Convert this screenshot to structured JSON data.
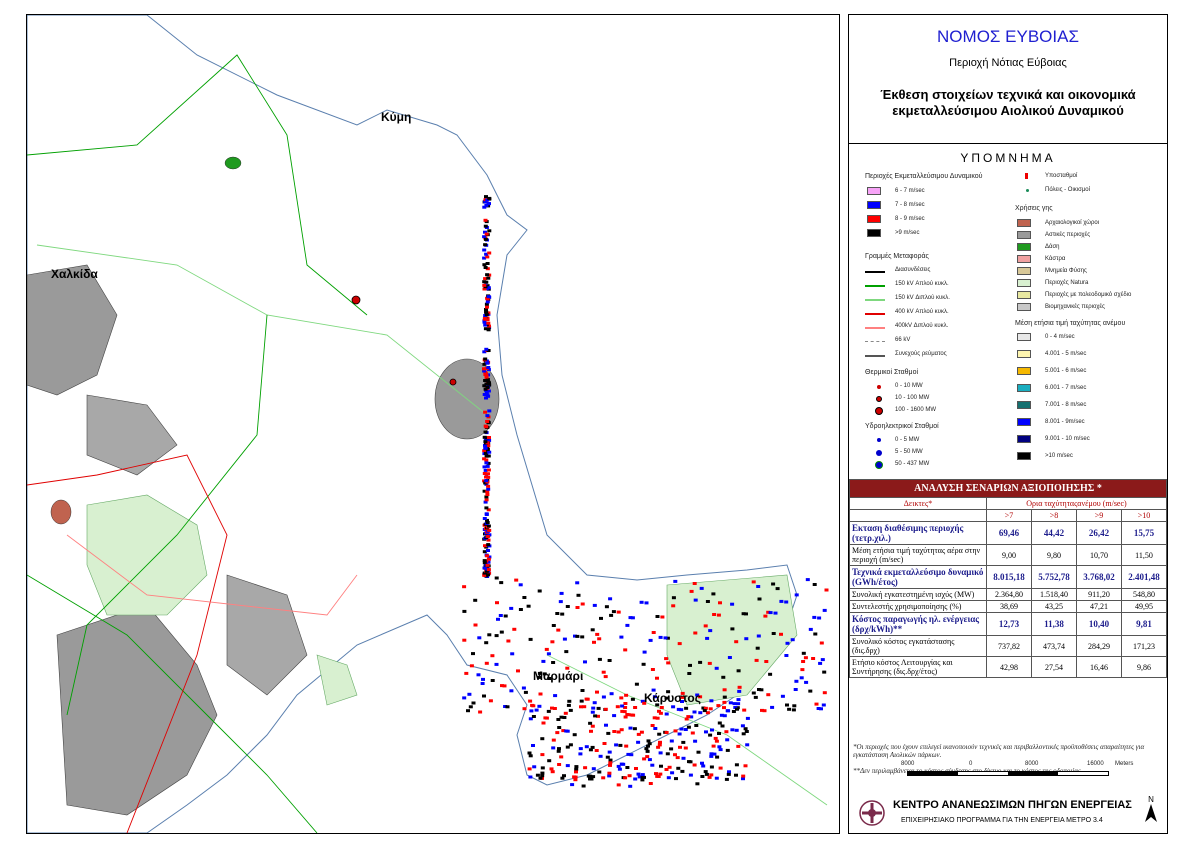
{
  "map": {
    "places": {
      "kymi": "Κύμη",
      "chalkida": "Χαλκίδα",
      "marmari": "Μαρμάρι",
      "karystos": "Κάρυστος"
    }
  },
  "header": {
    "title": "ΝΟΜΟΣ ΕΥΒΟΙΑΣ",
    "subtitle": "Περιοχή Νότιας Εύβοιας",
    "report": "Έκθεση στοιχείων τεχνικά και οικονομικά εκμεταλλεύσιμου Αιολικού Δυναμικού"
  },
  "legend": {
    "title": "ΥΠΟΜΝΗΜΑ",
    "left": {
      "wind_heading": "Περιοχές Εκμεταλλεύσιμου Δυναμικού",
      "wind_items": [
        {
          "label": "6 - 7 m/sec",
          "color": "#f7a3f7"
        },
        {
          "label": "7 - 8 m/sec",
          "color": "#0000ff"
        },
        {
          "label": "8 - 9 m/sec",
          "color": "#ff0000"
        },
        {
          "label": ">9 m/sec",
          "color": "#000000"
        }
      ],
      "lines_heading": "Γραμμές Μεταφοράς",
      "line_items": [
        {
          "label": "Διασυνδέσεις",
          "color": "#000000"
        },
        {
          "label": "150 kV Απλού κυκλ.",
          "color": "#00a000"
        },
        {
          "label": "150 kV Διπλού κυκλ.",
          "color": "#7fd87f"
        },
        {
          "label": "400 kV Απλού κυκλ.",
          "color": "#e00000"
        },
        {
          "label": "400kV Διπλού κυκλ.",
          "color": "#ff8080"
        },
        {
          "label": "66 kV",
          "color": "#888888"
        },
        {
          "label": "Συνεχούς ρεύματος",
          "color": "#555555"
        }
      ],
      "thermal_heading": "Θερμικοί Σταθμοί",
      "thermal_items": [
        "0 - 10 MW",
        "10 - 100 MW",
        "100 - 1600 MW"
      ],
      "hydro_heading": "Υδροηλεκτρικοί Σταθμοί",
      "hydro_items": [
        "0 - 5 MW",
        "5 - 50 MW",
        "50 - 437 MW"
      ]
    },
    "right": {
      "substations": "Υποσταθμοί",
      "towns": "Πόλεις - Οικισμοί",
      "landuse_heading": "Χρήσεις γης",
      "landuse_items": [
        {
          "label": "Αρχαιολογικοί χώροι",
          "color": "#c0634f"
        },
        {
          "label": "Αστικές περιοχές",
          "color": "#9a9a9a"
        },
        {
          "label": "Δάση",
          "color": "#1f9a1f"
        },
        {
          "label": "Κάστρα",
          "color": "#f0a0a0"
        },
        {
          "label": "Μνημεία Φύσης",
          "color": "#d8c898"
        },
        {
          "label": "Περιοχές Natura",
          "color": "#d8f0d0"
        },
        {
          "label": "Περιοχές με πολεοδομικό σχέδιο",
          "color": "#e8e8a0"
        },
        {
          "label": "Βιομηχανικές περιοχές",
          "color": "#c8c8c8"
        }
      ],
      "wind_speed_heading": "Μέση ετήσια τιμή ταχύτητας ανέμου",
      "wind_speed_items": [
        {
          "label": "0 - 4 m/sec",
          "color": "#e8e8e8"
        },
        {
          "label": "4.001 - 5 m/sec",
          "color": "#fff6b0"
        },
        {
          "label": "5.001 - 6 m/sec",
          "color": "#f5b800"
        },
        {
          "label": "6.001 - 7 m/sec",
          "color": "#1aaec0"
        },
        {
          "label": "7.001 - 8 m/sec",
          "color": "#157070"
        },
        {
          "label": "8.001 - 9m/sec",
          "color": "#0000ff"
        },
        {
          "label": "9.001 - 10 m/sec",
          "color": "#000080"
        },
        {
          "label": ">10 m/sec",
          "color": "#000000"
        }
      ]
    }
  },
  "scenarios": {
    "title": "ΑΝΑΛΥΣΗ ΣΕΝΑΡΙΩΝ ΑΞΙΟΠΟΙΗΣΗΣ *",
    "col_indicators": "Δεικτες*",
    "col_limit": "Ορια ταχύτηταςανέμου (m/sec)",
    "thresholds": [
      ">7",
      ">8",
      ">9",
      ">10"
    ],
    "rows": [
      {
        "label": "Εκταση διαθέσιμης περιοχής (τετρ.χιλ.)",
        "values": [
          "69,46",
          "44,42",
          "26,42",
          "15,75"
        ],
        "highlight": true
      },
      {
        "label": "Μέση ετήσια τιμή ταχύτητας αέρα στην περιοχή (m/sec)",
        "values": [
          "9,00",
          "9,80",
          "10,70",
          "11,50"
        ],
        "highlight": false
      },
      {
        "label": "Τεχνικά εκμεταλλεύσιμο δυναμικό (GWh/έτος)",
        "values": [
          "8.015,18",
          "5.752,78",
          "3.768,02",
          "2.401,48"
        ],
        "highlight": true
      },
      {
        "label": "Συνολική εγκατεστημένη ισχύς (MW)",
        "values": [
          "2.364,80",
          "1.518,40",
          "911,20",
          "548,80"
        ],
        "highlight": false
      },
      {
        "label": "Συντελεστής χρησιμοποίησης (%)",
        "values": [
          "38,69",
          "43,25",
          "47,21",
          "49,95"
        ],
        "highlight": false
      },
      {
        "label": "Κόστος παραγωγής ηλ. ενέργειας (δρχ/kWh)**",
        "values": [
          "12,73",
          "11,38",
          "10,40",
          "9,81"
        ],
        "highlight": true
      },
      {
        "label": "Συνολικό κόστος εγκατάστασης (δις.δρχ)",
        "values": [
          "737,82",
          "473,74",
          "284,29",
          "171,23"
        ],
        "highlight": false
      },
      {
        "label": "Ετήσιο κόστος Λειτουργίας και Συντήρησης (δις.δρχ/έτος)",
        "values": [
          "42,98",
          "27,54",
          "16,46",
          "9,86"
        ],
        "highlight": false
      }
    ],
    "note1": "*Οι περιοχές που έχουν επιλεγεί ικανοποιούν τεχνικές και περιβαλλοντικές προϋποθέσεις απαραίτητες για εγκατάσταση Αιολικών πάρκων.",
    "note2": "**Δεν περιλαμβάνεται το κόστος σύνδεσης στο δίκτυο και το κόστος της οδοποιίας"
  },
  "scalebar": {
    "ticks": [
      "8000",
      "0",
      "8000",
      "16000"
    ],
    "unit": "Meters"
  },
  "footer": {
    "organization": "ΚΕΝΤΡΟ ΑΝΑΝΕΩΣΙΜΩΝ ΠΗΓΩΝ ΕΝΕΡΓΕΙΑΣ",
    "program": "ΕΠΙΧΕΙΡΗΣΙΑΚΟ ΠΡΟΓΡΑΜΜΑ ΓΙΑ ΤΗΝ ΕΝΕΡΓΕΙΑ ΜΕΤΡΟ 3.4",
    "north": "N"
  }
}
